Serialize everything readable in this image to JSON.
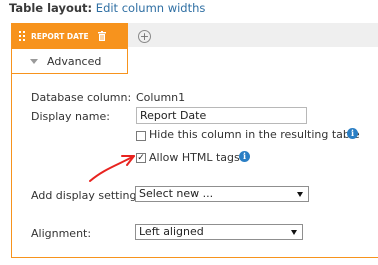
{
  "header": {
    "label": "Table layout:",
    "link": "Edit column widths"
  },
  "tabs": {
    "active": "REPORT DATE",
    "advanced": "Advanced"
  },
  "form": {
    "database_column_label": "Database column:",
    "database_column_value": "Column1",
    "display_name_label": "Display name:",
    "display_name_value": "Report Date",
    "hide_column_label": "Hide this column in the resulting table",
    "hide_column_checked": false,
    "allow_html_label": "Allow HTML tags",
    "allow_html_checked": true,
    "display_settings_label": "Add display settings:",
    "display_settings_value": "Select new ...",
    "alignment_label": "Alignment:",
    "alignment_value": "Left aligned"
  },
  "icons": [
    "grip-icon",
    "trash-icon",
    "add-icon",
    "chevron-down-icon",
    "info-icon",
    "dropdown-arrow-icon"
  ],
  "colors": {
    "accent": "#f7931d",
    "info": "#2a7ec4",
    "link": "#2f6fa3",
    "annotation": "#e8231f"
  }
}
